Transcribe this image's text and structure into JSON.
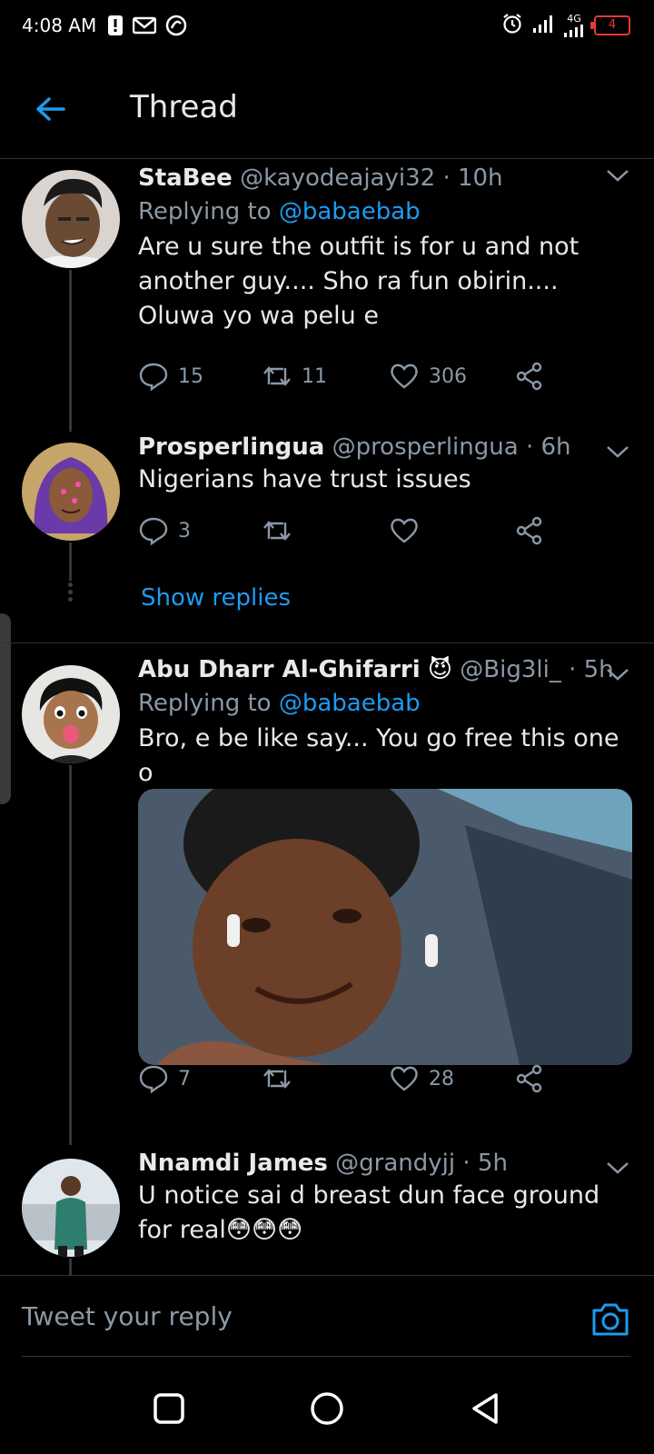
{
  "status_bar": {
    "time": "4:08 AM",
    "network": "4G",
    "battery": "4",
    "colors": {
      "battery": "#e53935"
    }
  },
  "header": {
    "title": "Thread"
  },
  "colors": {
    "accent": "#1d9bf0",
    "muted": "#8b98a5",
    "text": "#e7e9ea",
    "background": "#000000"
  },
  "tweets": [
    {
      "name": "StaBee",
      "handle": "@kayodeajayi32",
      "time": "10h",
      "replying_label": "Replying to",
      "replying_to": "@babaebab",
      "text": "Are u sure the outfit is for u and not another guy.... Sho ra fun obirin.... Oluwa yo wa pelu e",
      "replies": "15",
      "retweets": "11",
      "likes": "306"
    },
    {
      "name": "Prosperlingua",
      "handle": "@prosperlingua",
      "time": "6h",
      "text": "Nigerians have trust issues",
      "replies": "3",
      "retweets": "",
      "likes": ""
    },
    {
      "name": "Abu Dharr Al-Ghifarri",
      "name_emoji": "😈",
      "handle": "@Big3li_",
      "time": "5h",
      "replying_label": "Replying to",
      "replying_to": "@babaebab",
      "text": "Bro, e be like say... You go free this one o",
      "replies": "7",
      "retweets": "",
      "likes": "28"
    },
    {
      "name": "Nnamdi James",
      "handle": "@grandyjj",
      "time": "5h",
      "text": "U notice sai d breast dun face ground for real😳😳😳"
    }
  ],
  "show_replies": "Show replies",
  "reply_bar": {
    "placeholder": "Tweet your reply"
  },
  "icons": [
    "back-arrow-icon",
    "chevron-down-icon",
    "reply-icon",
    "retweet-icon",
    "like-icon",
    "share-icon",
    "camera-icon",
    "alarm-icon",
    "signal-icon",
    "mail-icon",
    "alert-icon"
  ]
}
